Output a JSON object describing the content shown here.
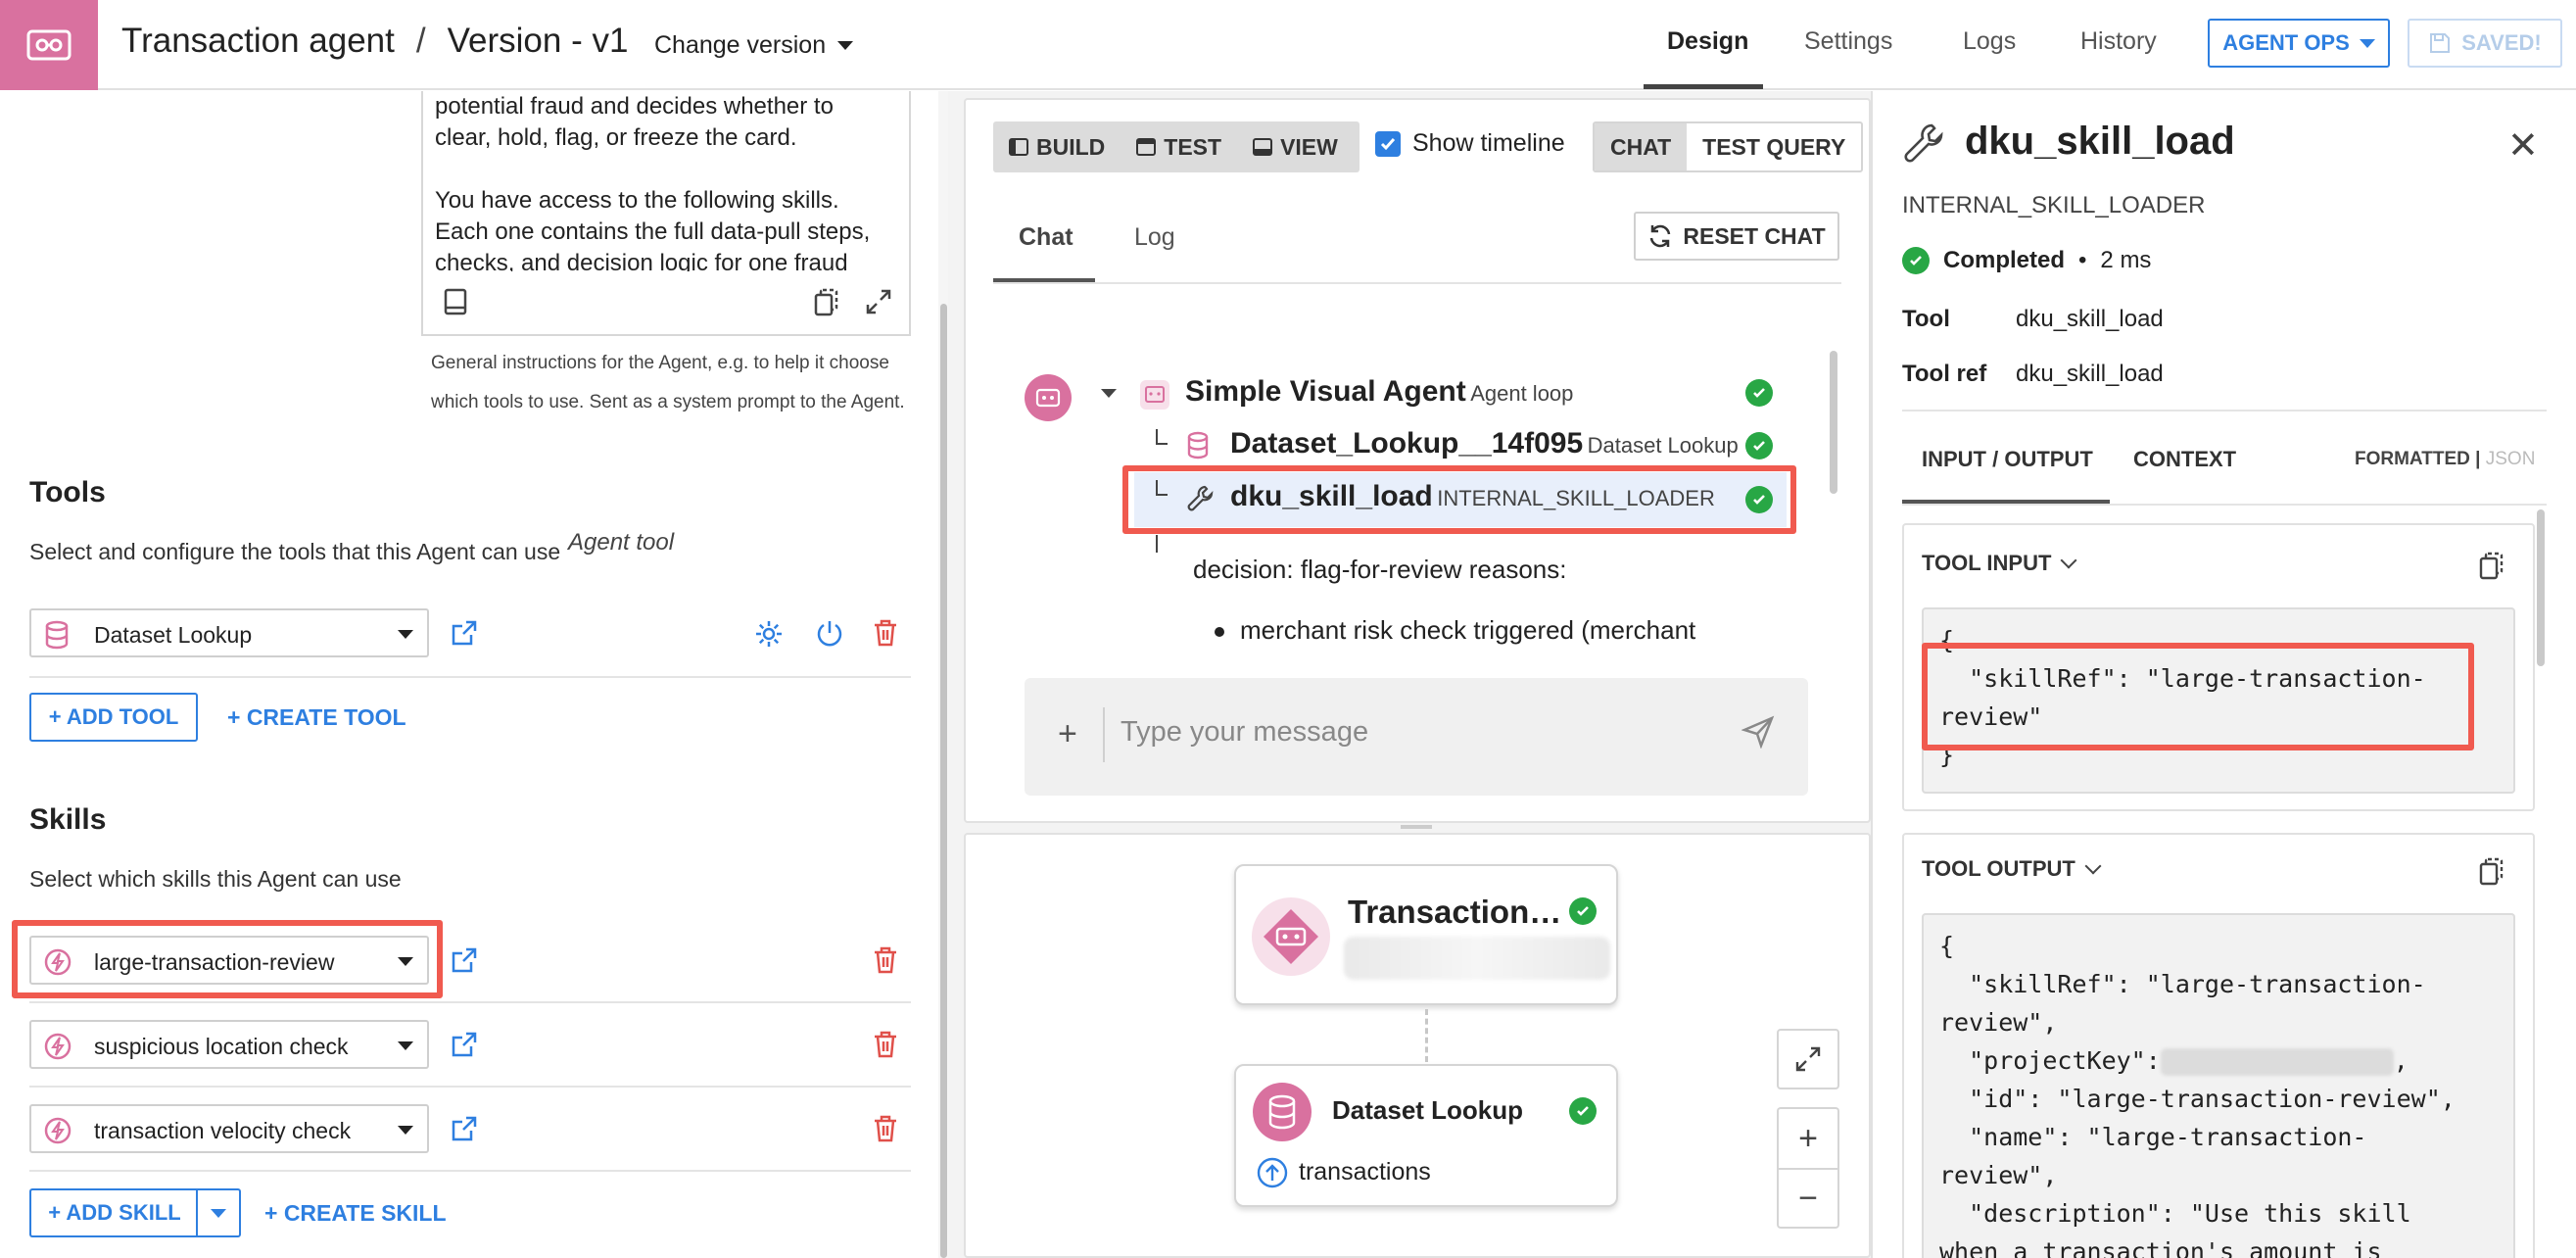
{
  "header": {
    "agent_name": "Transaction agent",
    "separator": "/",
    "version": "Version - v1",
    "change_version": "Change version",
    "tabs": {
      "design": "Design",
      "settings": "Settings",
      "logs": "Logs",
      "history": "History"
    },
    "agent_ops": "AGENT OPS",
    "saved": "SAVED!"
  },
  "left": {
    "prompt_text": "potential fraud and decides whether to clear, hold, flag, or freeze the card.\n\nYou have access to the following skills. Each one contains the full data-pull steps, checks, and decision logic for one fraud",
    "prompt_help": "General instructions for the Agent, e.g. to help it choose which tools to use. Sent as a system prompt to the Agent.",
    "tools": {
      "title": "Tools",
      "description": "Select and configure the tools that this Agent can use",
      "items": [
        {
          "label": "Dataset Lookup",
          "type": "Agent tool"
        }
      ],
      "add_tool": "+ ADD TOOL",
      "create_tool": "+ CREATE TOOL"
    },
    "skills": {
      "title": "Skills",
      "description": "Select which skills this Agent can use",
      "items": [
        {
          "label": "large-transaction-review"
        },
        {
          "label": "suspicious location check"
        },
        {
          "label": "transaction velocity check"
        }
      ],
      "add_skill": "+ ADD SKILL",
      "create_skill": "+ CREATE SKILL"
    }
  },
  "middle": {
    "modes": {
      "build": "BUILD",
      "test": "TEST",
      "view": "VIEW"
    },
    "show_timeline": "Show timeline",
    "chat_seg": "CHAT",
    "test_query_seg": "TEST QUERY",
    "tabs": {
      "chat": "Chat",
      "log": "Log"
    },
    "reset_chat": "RESET CHAT",
    "trace": {
      "root": {
        "name": "Simple Visual Agent",
        "type": "Agent loop"
      },
      "step1": {
        "name": "Dataset_Lookup__14f095",
        "type": "Dataset Lookup"
      },
      "step2": {
        "name": "dku_skill_load",
        "type": "INTERNAL_SKILL_LOADER"
      }
    },
    "decision": "decision: flag-for-review reasons:",
    "bullet": "merchant risk check triggered (merchant",
    "input_placeholder": "Type your message",
    "flow": {
      "agent_node_title": "Transaction…",
      "dataset_node_title": "Dataset Lookup",
      "dataset_node_sub": "transactions"
    }
  },
  "right": {
    "title": "dku_skill_load",
    "subtitle": "INTERNAL_SKILL_LOADER",
    "status": "Completed",
    "duration": "2 ms",
    "tool_key": "Tool",
    "tool_val": "dku_skill_load",
    "toolref_key": "Tool ref",
    "toolref_val": "dku_skill_load",
    "tabs": {
      "io": "INPUT / OUTPUT",
      "context": "CONTEXT"
    },
    "format_formatted": "FORMATTED",
    "format_sep": "|",
    "format_json": "JSON",
    "tool_input_title": "TOOL INPUT",
    "tool_output_title": "TOOL OUTPUT",
    "input_code": {
      "l1": "{",
      "l2": "  \"skillRef\": \"large-transaction-",
      "l3": "review\"",
      "l4": "}"
    },
    "output_code": {
      "l1": "{",
      "l2": "  \"skillRef\": \"large-transaction-",
      "l3": "review\",",
      "l4a": "  \"projectKey\":",
      "l4b": ",",
      "l5": "  \"id\": \"large-transaction-review\",",
      "l6": "  \"name\": \"large-transaction-",
      "l7": "review\",",
      "l8": "  \"description\": \"Use this skill",
      "l9": "when a transaction's amount is"
    }
  },
  "colors": {
    "brand": "#d9719f",
    "accent": "#2e7fe0",
    "success": "#28a745",
    "highlight": "#f05a4f",
    "danger": "#e0504a"
  }
}
